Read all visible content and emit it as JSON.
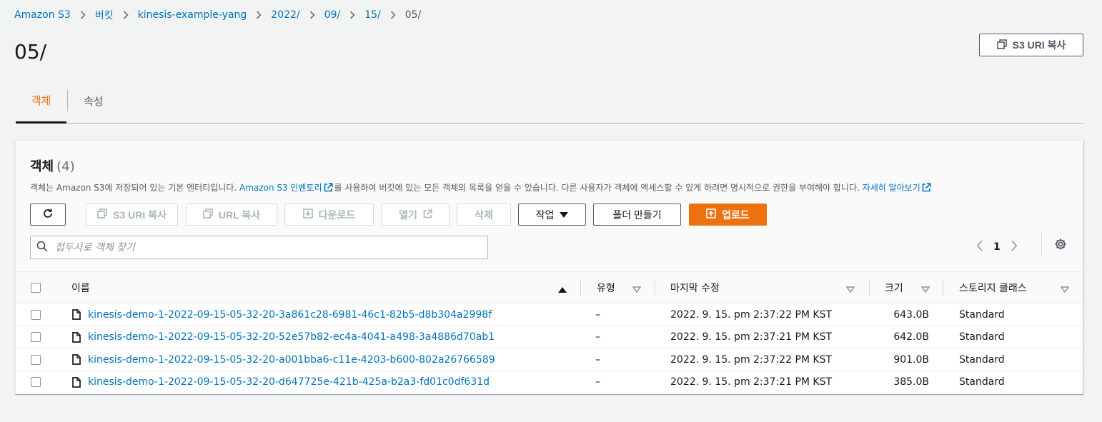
{
  "breadcrumb": {
    "items": [
      "Amazon S3",
      "버킷",
      "kinesis-example-yang",
      "2022/",
      "09/",
      "15/"
    ],
    "current": "05/"
  },
  "page": {
    "title": "05/",
    "copy_uri_label": "S3 URI 복사"
  },
  "tabs": [
    {
      "label": "객체",
      "active": true
    },
    {
      "label": "속성",
      "active": false
    }
  ],
  "objects_panel": {
    "title": "객체",
    "count": "(4)",
    "description_prefix": "객체는 Amazon S3에 저장되어 있는 기본 엔터티입니다. ",
    "inventory_link": "Amazon S3 인벤토리",
    "description_middle": "를 사용하여 버킷에 있는 모든 객체의 목록을 얻을 수 있습니다. 다른 사용자가 객체에 액세스할 수 있게 하려면 명시적으로 권한을 부여해야 합니다. ",
    "learn_more_link": "자세히 알아보기"
  },
  "toolbar": {
    "refresh_icon": "refresh-icon",
    "copy_s3_uri": "S3 URI 복사",
    "copy_url": "URL 복사",
    "download": "다운로드",
    "open": "열기",
    "delete": "삭제",
    "actions": "작업",
    "create_folder": "폴더 만들기",
    "upload": "업로드"
  },
  "search": {
    "placeholder": "접두사로 객체 찾기"
  },
  "pagination": {
    "current_page": "1"
  },
  "table": {
    "columns": [
      "이름",
      "유형",
      "마지막 수정",
      "크기",
      "스토리지 클래스"
    ],
    "rows": [
      {
        "name": "kinesis-demo-1-2022-09-15-05-32-20-3a861c28-6981-46c1-82b5-d8b304a2998f",
        "type": "–",
        "modified": "2022. 9. 15. pm 2:37:22 PM KST",
        "size": "643.0B",
        "storage": "Standard"
      },
      {
        "name": "kinesis-demo-1-2022-09-15-05-32-20-52e57b82-ec4a-4041-a498-3a4886d70ab1",
        "type": "–",
        "modified": "2022. 9. 15. pm 2:37:21 PM KST",
        "size": "642.0B",
        "storage": "Standard"
      },
      {
        "name": "kinesis-demo-1-2022-09-15-05-32-20-a001bba6-c11e-4203-b600-802a26766589",
        "type": "–",
        "modified": "2022. 9. 15. pm 2:37:22 PM KST",
        "size": "901.0B",
        "storage": "Standard"
      },
      {
        "name": "kinesis-demo-1-2022-09-15-05-32-20-d647725e-421b-425a-b2a3-fd01c0df631d",
        "type": "–",
        "modified": "2022. 9. 15. pm 2:37:21 PM KST",
        "size": "385.0B",
        "storage": "Standard"
      }
    ]
  },
  "colors": {
    "accent": "#ec7211",
    "link": "#0073bb",
    "text": "#16191f",
    "background": "#f2f3f3"
  }
}
